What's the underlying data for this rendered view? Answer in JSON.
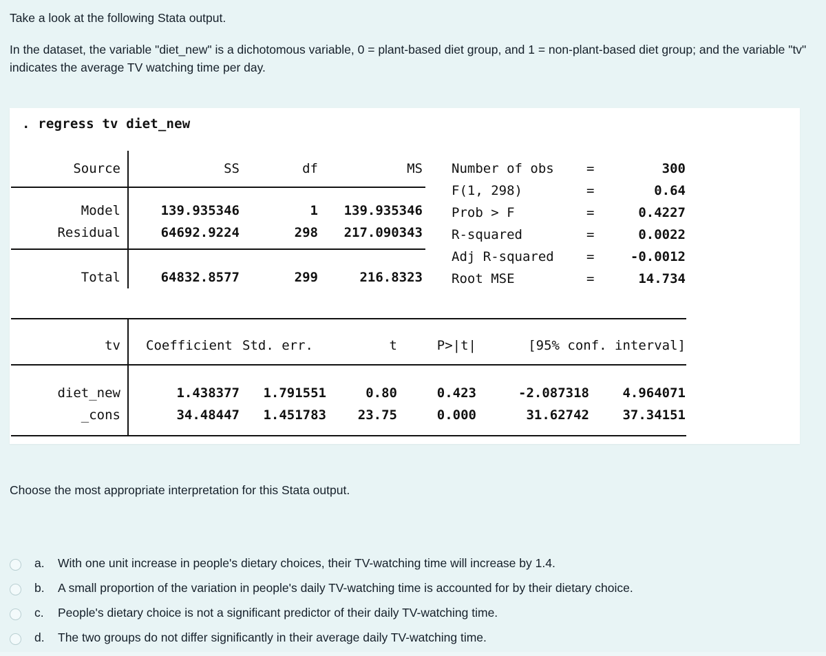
{
  "intro": {
    "lead": "Take a look at the following Stata output.",
    "detail": "In the dataset, the variable \"diet_new\" is a dichotomous variable, 0 = plant-based diet group, and 1 = non-plant-based diet group; and the variable \"tv\" indicates the average TV watching time per day."
  },
  "stata": {
    "command": ". regress tv diet_new",
    "anova": {
      "headers": {
        "source": "Source",
        "ss": "SS",
        "df": "df",
        "ms": "MS"
      },
      "rows": [
        {
          "label": "Model",
          "ss": "139.935346",
          "df": "1",
          "ms": "139.935346"
        },
        {
          "label": "Residual",
          "ss": "64692.9224",
          "df": "298",
          "ms": "217.090343"
        }
      ],
      "total": {
        "label": "Total",
        "ss": "64832.8577",
        "df": "299",
        "ms": "216.8323"
      }
    },
    "stats": [
      {
        "label": "Number of obs",
        "eq": "=",
        "value": "300"
      },
      {
        "label": "F(1, 298)",
        "eq": "=",
        "value": "0.64"
      },
      {
        "label": "Prob > F",
        "eq": "=",
        "value": "0.4227"
      },
      {
        "label": "R-squared",
        "eq": "=",
        "value": "0.0022"
      },
      {
        "label": "Adj R-squared",
        "eq": "=",
        "value": "-0.0012"
      },
      {
        "label": "Root MSE",
        "eq": "=",
        "value": "14.734"
      }
    ],
    "coef": {
      "headers": {
        "dep": "tv",
        "coefficient": "Coefficient",
        "stderr": "Std. err.",
        "t": "t",
        "p": "P>|t|",
        "ci": "[95% conf. interval]"
      },
      "rows": [
        {
          "label": "diet_new",
          "coefficient": "1.438377",
          "stderr": "1.791551",
          "t": "0.80",
          "p": "0.423",
          "ci_low": "-2.087318",
          "ci_high": "4.964071"
        },
        {
          "label": "_cons",
          "coefficient": "34.48447",
          "stderr": "1.451783",
          "t": "23.75",
          "p": "0.000",
          "ci_low": "31.62742",
          "ci_high": "37.34151"
        }
      ]
    }
  },
  "question": {
    "prompt": "Choose the most appropriate interpretation for this Stata output.",
    "options": [
      {
        "letter": "a.",
        "text": "With one unit increase in people's dietary choices, their TV-watching time will increase by 1.4."
      },
      {
        "letter": "b.",
        "text": "A small proportion of the variation in people's daily TV-watching time is accounted for by their dietary choice."
      },
      {
        "letter": "c.",
        "text": "People's dietary choice is not a significant predictor of their daily TV-watching time."
      },
      {
        "letter": "d.",
        "text": "The two groups do not differ significantly in their average daily TV-watching time."
      }
    ]
  },
  "colors": {
    "page_background": "#e8f4f5",
    "panel_background": "#ffffff",
    "text": "#16202a",
    "rule": "#111111",
    "radio_border": "#b9cfd2"
  }
}
